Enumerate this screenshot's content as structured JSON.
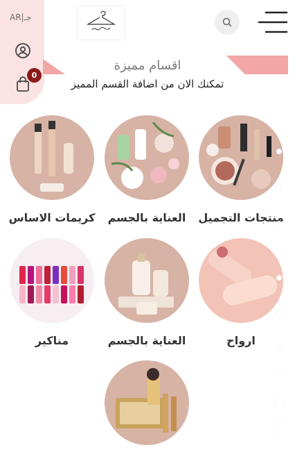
{
  "header": {
    "lang_label": "AR|جـ",
    "cart_count": "0",
    "logo_alt": "logo",
    "search_icon": "search-icon",
    "menu_icon": "menu-icon"
  },
  "section": {
    "title": "اقسام مميزة",
    "subtitle": "تمكنك الان من اضافة القسم المميز"
  },
  "categories": [
    {
      "label": "منتجات التجميل"
    },
    {
      "label": "العناية بالجسم"
    },
    {
      "label": "كريمات الاساس"
    },
    {
      "label": "ارواح"
    },
    {
      "label": "العناية بالجسم"
    },
    {
      "label": "مناكير"
    }
  ],
  "colors": {
    "accent_pink": "#f3a6a6",
    "sidebar_pink": "#fbe3e3",
    "badge": "#8b1a1a",
    "circle_bg": "#d7b3a5"
  }
}
